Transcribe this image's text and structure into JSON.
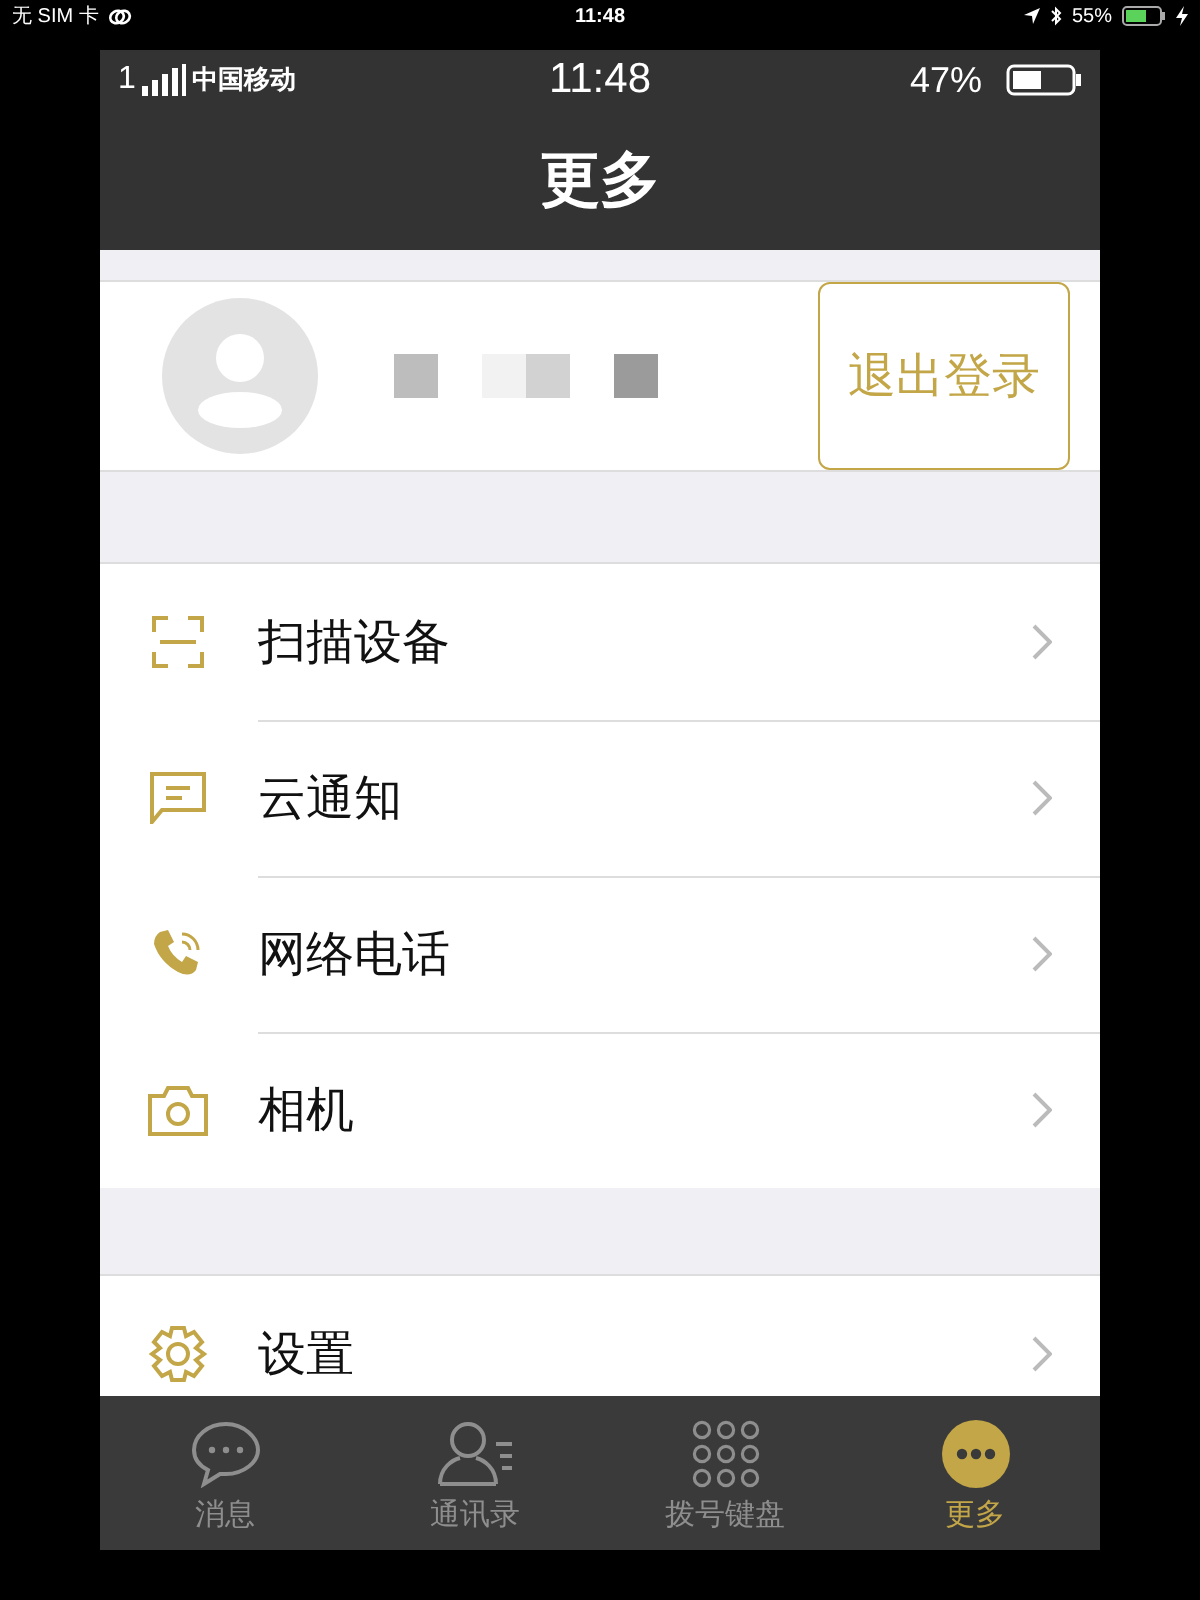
{
  "device_status": {
    "carrier": "无 SIM 卡",
    "time": "11:48",
    "battery": "55%"
  },
  "app_status": {
    "signal_prefix": "1",
    "carrier": "中国移动",
    "time": "11:48",
    "battery": "47%"
  },
  "nav": {
    "title": "更多"
  },
  "profile": {
    "logout_button": "退出登录"
  },
  "menu_groups": [
    [
      {
        "kind": "scan",
        "label": "扫描设备"
      },
      {
        "kind": "message",
        "label": "云通知"
      },
      {
        "kind": "phone",
        "label": "网络电话"
      },
      {
        "kind": "camera",
        "label": "相机"
      }
    ],
    [
      {
        "kind": "settings",
        "label": "设置"
      }
    ]
  ],
  "tabs": [
    {
      "kind": "chat",
      "label": "消息",
      "selected": false
    },
    {
      "kind": "contacts",
      "label": "通讯录",
      "selected": false
    },
    {
      "kind": "keypad",
      "label": "拨号键盘",
      "selected": false
    },
    {
      "kind": "more",
      "label": "更多",
      "selected": true
    }
  ]
}
